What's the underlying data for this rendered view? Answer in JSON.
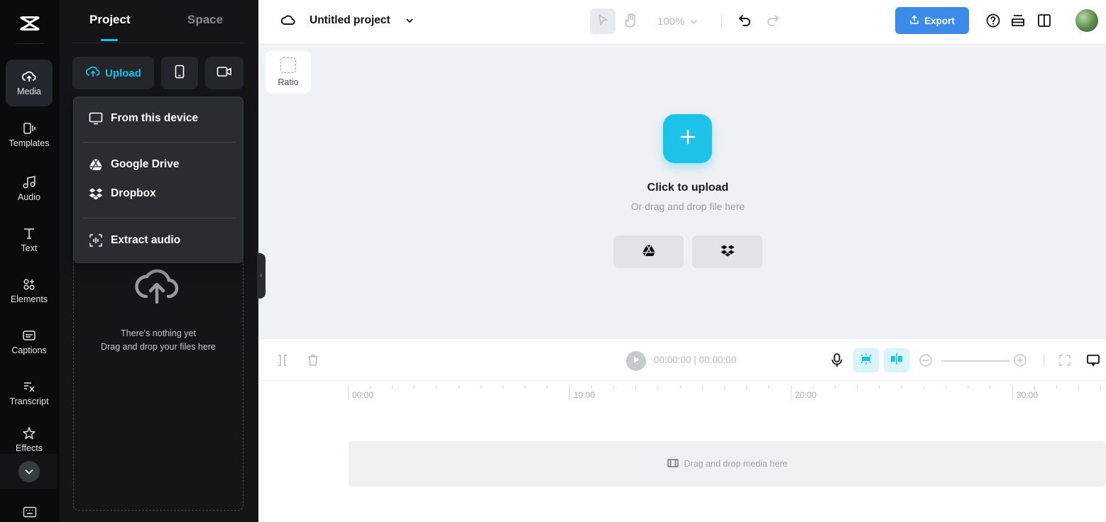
{
  "rail": {
    "items": [
      {
        "label": "Media"
      },
      {
        "label": "Templates"
      },
      {
        "label": "Audio"
      },
      {
        "label": "Text"
      },
      {
        "label": "Elements"
      },
      {
        "label": "Captions"
      },
      {
        "label": "Transcript"
      },
      {
        "label": "Effects"
      }
    ]
  },
  "panel": {
    "tabs": [
      {
        "label": "Project",
        "active": true
      },
      {
        "label": "Space",
        "active": false
      }
    ],
    "upload_label": "Upload",
    "empty_title": "There's nothing yet",
    "empty_sub": "Drag and drop your files here"
  },
  "upload_menu": {
    "items": [
      {
        "label": "From this device",
        "icon": "monitor-icon"
      },
      {
        "label": "Google Drive",
        "icon": "google-drive-icon"
      },
      {
        "label": "Dropbox",
        "icon": "dropbox-icon"
      },
      {
        "label": "Extract audio",
        "icon": "extract-audio-icon"
      }
    ]
  },
  "topbar": {
    "project_title": "Untitled project",
    "zoom": "100%",
    "export_label": "Export"
  },
  "canvas": {
    "ratio_label": "Ratio",
    "upload_title": "Click to upload",
    "upload_sub": "Or drag and drop file here"
  },
  "timeline": {
    "current_time": "00:00:00",
    "total_time": "00:00:00",
    "ruler_labels": [
      "00:00",
      "10:00",
      "20:00",
      "30:00"
    ],
    "track_placeholder": "Drag and drop media here"
  },
  "colors": {
    "accent": "#16c3e6",
    "export_bg": "#3d8be9",
    "rail_bg": "#0b0b0d",
    "panel_bg": "#151518"
  }
}
